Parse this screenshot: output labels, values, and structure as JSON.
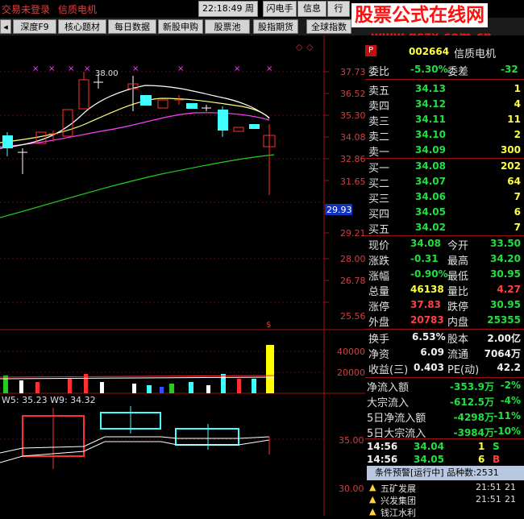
{
  "top": {
    "status": "交易未登录",
    "stock_name_top": "信质电机",
    "clock": "22:18:49",
    "weekday": "周一",
    "buttons": [
      "闪电手",
      "信息",
      "行"
    ]
  },
  "toolbar": {
    "buttons": [
      "深度F9",
      "核心题材",
      "每日数据",
      "新股申购",
      "股票池",
      "股指期货",
      "全球指数"
    ]
  },
  "watermark": {
    "title": "股票公式在线网",
    "url": "www.gszx.com.cn"
  },
  "chart": {
    "price_ticks": [
      "37.73",
      "36.52",
      "35.30",
      "34.08",
      "32.86",
      "31.65",
      "29.93",
      "29.21",
      "28.00",
      "26.78",
      "25.56"
    ],
    "current_price_tag": "29.93",
    "high_label": "38.00",
    "volume_ticks": [
      "40000",
      "20000"
    ],
    "indicator_line": "W5: 35.23  W9: 34.32",
    "lower_ticks": [
      "35.00",
      "30.00"
    ],
    "colors": {
      "up": "#ff3030",
      "down": "#40ffff",
      "ma5": "#ffffff",
      "ma10": "#ffff80",
      "ma20": "#ff40ff",
      "ma60": "#20d020"
    }
  },
  "panel": {
    "code": "002664",
    "name": "信质电机",
    "weibi_label": "委比",
    "weibi": "-5.30%",
    "weicha_label": "委差",
    "weicha": "-32",
    "asks": [
      {
        "label": "卖五",
        "price": "34.13",
        "vol": "1"
      },
      {
        "label": "卖四",
        "price": "34.12",
        "vol": "4"
      },
      {
        "label": "卖三",
        "price": "34.11",
        "vol": "11"
      },
      {
        "label": "卖二",
        "price": "34.10",
        "vol": "2"
      },
      {
        "label": "卖一",
        "price": "34.09",
        "vol": "300"
      }
    ],
    "bids": [
      {
        "label": "买一",
        "price": "34.08",
        "vol": "202"
      },
      {
        "label": "买二",
        "price": "34.07",
        "vol": "64"
      },
      {
        "label": "买三",
        "price": "34.06",
        "vol": "7"
      },
      {
        "label": "买四",
        "price": "34.05",
        "vol": "6"
      },
      {
        "label": "买五",
        "price": "34.02",
        "vol": "7"
      }
    ],
    "stats": [
      {
        "l1": "现价",
        "v1": "34.08",
        "c1": "grn",
        "l2": "今开",
        "v2": "33.50",
        "c2": "grn"
      },
      {
        "l1": "涨跌",
        "v1": "-0.31",
        "c1": "grn",
        "l2": "最高",
        "v2": "34.20",
        "c2": "grn"
      },
      {
        "l1": "涨幅",
        "v1": "-0.90%",
        "c1": "grn",
        "l2": "最低",
        "v2": "30.95",
        "c2": "grn"
      },
      {
        "l1": "总量",
        "v1": "46138",
        "c1": "yel",
        "l2": "量比",
        "v2": "4.27",
        "c2": "red"
      },
      {
        "l1": "涨停",
        "v1": "37.83",
        "c1": "red",
        "l2": "跌停",
        "v2": "30.95",
        "c2": "grn"
      },
      {
        "l1": "外盘",
        "v1": "20783",
        "c1": "red",
        "l2": "内盘",
        "v2": "25355",
        "c2": "grn"
      }
    ],
    "fin": [
      {
        "l1": "换手",
        "v1": "6.53%",
        "l2": "股本",
        "v2": "2.00亿"
      },
      {
        "l1": "净资",
        "v1": "6.09",
        "l2": "流通",
        "v2": "7064万"
      },
      {
        "l1": "收益(三)",
        "v1": "0.403",
        "l2": "PE(动)",
        "v2": "42.2"
      }
    ],
    "flows": [
      {
        "l": "净流入额",
        "v": "-353.9万",
        "p": "-2%"
      },
      {
        "l": "大宗流入",
        "v": "-612.5万",
        "p": "-4%"
      },
      {
        "l": "5日净流入额",
        "v": "-4298万",
        "p": "-11%"
      },
      {
        "l": "5日大宗流入",
        "v": "-3984万",
        "p": "-10%"
      }
    ],
    "ticks": [
      {
        "t": "14:56",
        "p": "34.04",
        "v": "1",
        "s": "S"
      },
      {
        "t": "14:56",
        "p": "34.05",
        "v": "6",
        "s": "B"
      }
    ],
    "alert_header": "条件预警[运行中] 品种数:2531",
    "alerts": [
      {
        "name": "五矿发展",
        "time": "21:51",
        "v": "21"
      },
      {
        "name": "兴发集团",
        "time": "21:51",
        "v": "21"
      },
      {
        "name": "钱江水利",
        "time": "",
        "v": ""
      }
    ]
  }
}
